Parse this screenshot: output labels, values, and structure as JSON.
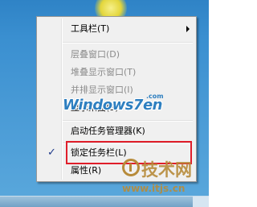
{
  "menu": {
    "items": [
      {
        "label": "工具栏(T)",
        "enabled": true,
        "has_submenu": true,
        "checked": false
      },
      {
        "label": "层叠窗口(D)",
        "enabled": false,
        "has_submenu": false,
        "checked": false
      },
      {
        "label": "堆叠显示窗口(T)",
        "enabled": false,
        "has_submenu": false,
        "checked": false
      },
      {
        "label": "并排显示窗口(I)",
        "enabled": false,
        "has_submenu": false,
        "checked": false
      },
      {
        "label": "显示桌面(S)",
        "enabled": true,
        "has_submenu": false,
        "checked": false
      },
      {
        "label": "启动任务管理器(K)",
        "enabled": true,
        "has_submenu": false,
        "checked": false
      },
      {
        "label": "锁定任务栏(L)",
        "enabled": true,
        "has_submenu": false,
        "checked": true
      },
      {
        "label": "属性(R)",
        "enabled": true,
        "has_submenu": false,
        "checked": false
      }
    ],
    "check_glyph": "✓"
  },
  "watermarks": {
    "windows7en": {
      "main": "Windows7en",
      "suffix": ".com"
    },
    "itjs": {
      "text": "技术网",
      "url": "www.itjs.cn"
    }
  },
  "colors": {
    "highlight_box": "#e01e2a",
    "menu_bg": "#f0f0f0",
    "disabled_text": "#8b8b8b",
    "desktop_blue": "#3a8fd0"
  }
}
